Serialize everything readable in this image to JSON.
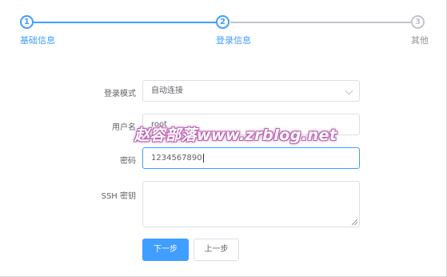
{
  "steps": [
    {
      "number": "1",
      "label": "基础信息",
      "state": "done"
    },
    {
      "number": "2",
      "label": "登录信息",
      "state": "active"
    },
    {
      "number": "3",
      "label": "其他",
      "state": "todo"
    }
  ],
  "colors": {
    "primary": "#409eff",
    "inactive": "#c0c4cc",
    "border": "#dcdfe6"
  },
  "form": {
    "login_mode": {
      "label": "登录模式",
      "value": "自动连接"
    },
    "username": {
      "label": "用户名",
      "value": "root"
    },
    "password": {
      "label": "密码",
      "value": "1234567890"
    },
    "ssh_key": {
      "label": "SSH 密钥",
      "value": ""
    }
  },
  "buttons": {
    "next": "下一步",
    "prev": "上一步"
  },
  "watermark": "赵容部落www.zrblog.net"
}
